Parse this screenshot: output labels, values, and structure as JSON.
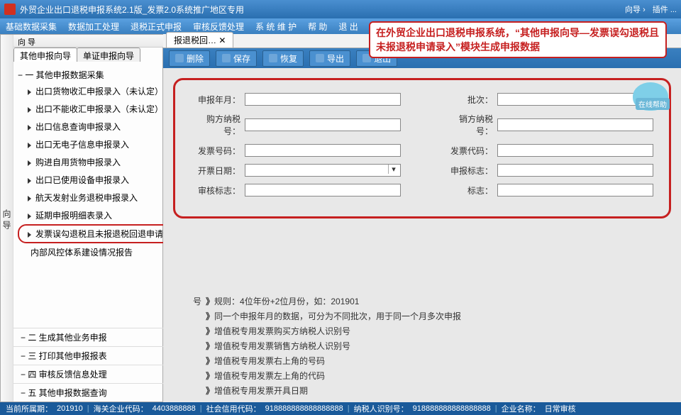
{
  "app": {
    "title": "外贸企业出口退税申报系统2.1版_发票2.0系统推广地区专用"
  },
  "top_right": {
    "wizard": "向导 ›",
    "more": "插件 ..."
  },
  "menubar": [
    "基础数据采集",
    "数据加工处理",
    "退税正式申报",
    "审核反馈处理",
    "系 统 维 护",
    "帮 助",
    "退 出"
  ],
  "left": {
    "vtab": "向导",
    "panel_title": "向 导",
    "pins": "↔ ✕",
    "subtabs": [
      {
        "label": "其他申报向导",
        "active": true
      },
      {
        "label": "单证申报向导",
        "active": false
      }
    ],
    "group1": {
      "label": "一 其他申报数据采集",
      "items": [
        "出口货物收汇申报录入（未认定）",
        "出口不能收汇申报录入（未认定）",
        "出口信息查询申报录入",
        "出口无电子信息申报录入",
        "购进自用货物申报录入",
        "出口已使用设备申报录入",
        "航天发射业务退税申报录入",
        "延期申报明细表录入",
        "发票误勾退税且未报退税回退申请录入",
        "内部风控体系建设情况报告"
      ],
      "hl_index": 8
    },
    "footer_groups": [
      "二 生成其他业务申报",
      "三 打印其他申报报表",
      "四 审核反馈信息处理",
      "五 其他申报数据查询"
    ]
  },
  "doc_tab": "报退税回…  ✕",
  "toolbar": [
    {
      "icon": "trash-icon",
      "label": "删除"
    },
    {
      "icon": "save-icon",
      "label": "保存"
    },
    {
      "icon": "undo-icon",
      "label": "恢复"
    },
    {
      "icon": "export-icon",
      "label": "导出"
    },
    {
      "icon": "exit-icon",
      "label": "退出"
    }
  ],
  "annotation": "在外贸企业出口退税申报系统，“其他申报向导—发票误勾退税且未报退税申请录入”模块生成申报数据",
  "form": {
    "left_fields": [
      {
        "label": "申报年月：",
        "type": "input"
      },
      {
        "label": "购方纳税号：",
        "type": "input"
      },
      {
        "label": "发票号码：",
        "type": "input"
      },
      {
        "label": "开票日期：",
        "type": "select"
      },
      {
        "label": "审核标志：",
        "type": "input"
      }
    ],
    "right_fields": [
      {
        "label": "批次：",
        "type": "input"
      },
      {
        "label": "销方纳税号：",
        "type": "input"
      },
      {
        "label": "发票代码：",
        "type": "input"
      },
      {
        "label": "申报标志：",
        "type": "input"
      },
      {
        "label": "标志：",
        "type": "input"
      }
    ]
  },
  "rules": {
    "left_lead": "号",
    "first": {
      "label": "规则：",
      "text": "4位年份+2位月份，如：201901"
    },
    "rest": [
      "同一个申报年月的数据，可分为不同批次，用于同一个月多次申报",
      "增值税专用发票购买方纳税人识别号",
      "增值税专用发票销售方纳税人识别号",
      "增值税专用发票右上角的号码",
      "增值税专用发票左上角的代码",
      "增值税专用发票开具日期"
    ]
  },
  "mascot": {
    "tag": "在线帮助"
  },
  "status": {
    "items": [
      {
        "k": "当前所属期：",
        "v": "201910"
      },
      {
        "k": "海关企业代码：",
        "v": "4403888888"
      },
      {
        "k": "社会信用代码：",
        "v": "918888888888888888"
      },
      {
        "k": "纳税人识别号：",
        "v": "918888888888888888"
      },
      {
        "k": "企业名称：",
        "v": "日常审核"
      }
    ]
  }
}
